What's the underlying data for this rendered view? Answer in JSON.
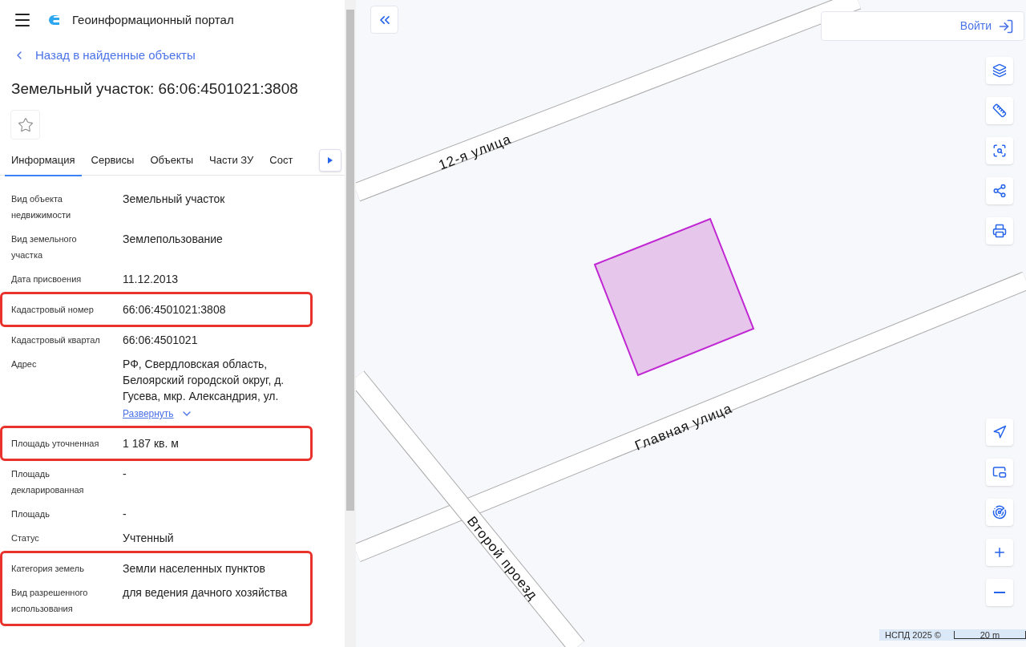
{
  "header": {
    "title": "Геоинформационный портал"
  },
  "back_link": "Назад в найденные объекты",
  "object_title": "Земельный участок: 66:06:4501021:3808",
  "favorite": {
    "on": false
  },
  "tabs": [
    {
      "label": "Информация",
      "selected": true
    },
    {
      "label": "Сервисы",
      "selected": false
    },
    {
      "label": "Объекты",
      "selected": false
    },
    {
      "label": "Части ЗУ",
      "selected": false
    },
    {
      "label": "Сост",
      "selected": false
    }
  ],
  "groups": [
    {
      "highlighted": false,
      "rows": [
        {
          "label": "Вид объекта недвижимости",
          "value": "Земельный участок"
        },
        {
          "label": "Вид земельного участка",
          "value": "Землепользование"
        },
        {
          "label": "Дата присвоения",
          "value": "11.12.2013"
        }
      ]
    },
    {
      "highlighted": true,
      "rows": [
        {
          "label": "Кадастровый номер",
          "value": "66:06:4501021:3808"
        }
      ]
    },
    {
      "highlighted": false,
      "rows": [
        {
          "label": "Кадастровый квартал",
          "value": "66:06:4501021"
        },
        {
          "label": "Адрес",
          "value": "РФ, Свердловская область, Белоярский городской округ, д. Гусева, мкр. Александрия, ул.",
          "expand_link": "Развернуть"
        }
      ]
    },
    {
      "highlighted": true,
      "rows": [
        {
          "label": "Площадь уточненная",
          "value": "1 187 кв. м"
        }
      ]
    },
    {
      "highlighted": false,
      "rows": [
        {
          "label": "Площадь декларированная",
          "value": "-"
        },
        {
          "label": "Площадь",
          "value": "-"
        },
        {
          "label": "Статус",
          "value": "Учтенный"
        }
      ]
    },
    {
      "highlighted": true,
      "rows": [
        {
          "label": "Категория земель",
          "value": "Земли населенных пунктов"
        },
        {
          "label": "Вид разрешенного использования",
          "value": "для ведения дачного хозяйства"
        }
      ]
    }
  ],
  "map": {
    "login": "Войти",
    "roads": [
      {
        "label": "12-я улица"
      },
      {
        "label": "Главная улица"
      },
      {
        "label": "Второй проезд"
      }
    ],
    "attribution": "НСПД 2025 ©",
    "scale": "20 m"
  }
}
